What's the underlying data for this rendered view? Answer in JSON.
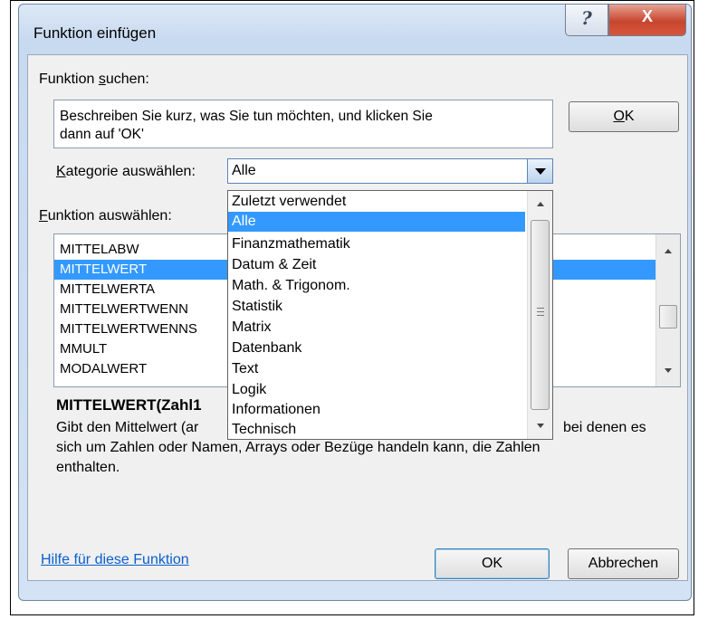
{
  "window": {
    "title": "Funktion einfügen",
    "help_glyph": "?",
    "close_glyph": "X"
  },
  "search": {
    "label_pre": "Funktion ",
    "label_acc": "s",
    "label_post": "uchen:",
    "text_line1": "Beschreiben Sie kurz, was Sie tun möchten, und klicken Sie",
    "text_line2": "dann auf 'OK'",
    "ok_acc": "O",
    "ok_post": "K"
  },
  "category": {
    "label_acc": "K",
    "label_post": "ategorie auswählen:",
    "selected": "Alle",
    "options": [
      "Zuletzt verwendet",
      "Alle",
      "Finanzmathematik",
      "Datum & Zeit",
      "Math. & Trigonom.",
      "Statistik",
      "Matrix",
      "Datenbank",
      "Text",
      "Logik",
      "Informationen",
      "Technisch"
    ],
    "highlighted_index": 1
  },
  "function_list": {
    "label_acc": "F",
    "label_post": "unktion auswählen:",
    "items": [
      "MITTELABW",
      "MITTELWERT",
      "MITTELWERTA",
      "MITTELWERTWENN",
      "MITTELWERTWENNS",
      "MMULT",
      "MODALWERT"
    ],
    "selected_index": 1
  },
  "details": {
    "syntax": "MITTELWERT(Zahl1",
    "desc_line1_a": "Gibt den Mittelwert (ar",
    "desc_line1_b": "bei denen es",
    "desc_line2": "sich um Zahlen oder Namen, Arrays oder Bezüge handeln kann, die Zahlen",
    "desc_line3": "enthalten."
  },
  "footer": {
    "help_link": "Hilfe für diese Funktion",
    "ok_label": "OK",
    "cancel_label": "Abbrechen"
  },
  "colors": {
    "selection": "#3399ff",
    "link": "#0a5fcf",
    "close_button": "#c7462f"
  }
}
